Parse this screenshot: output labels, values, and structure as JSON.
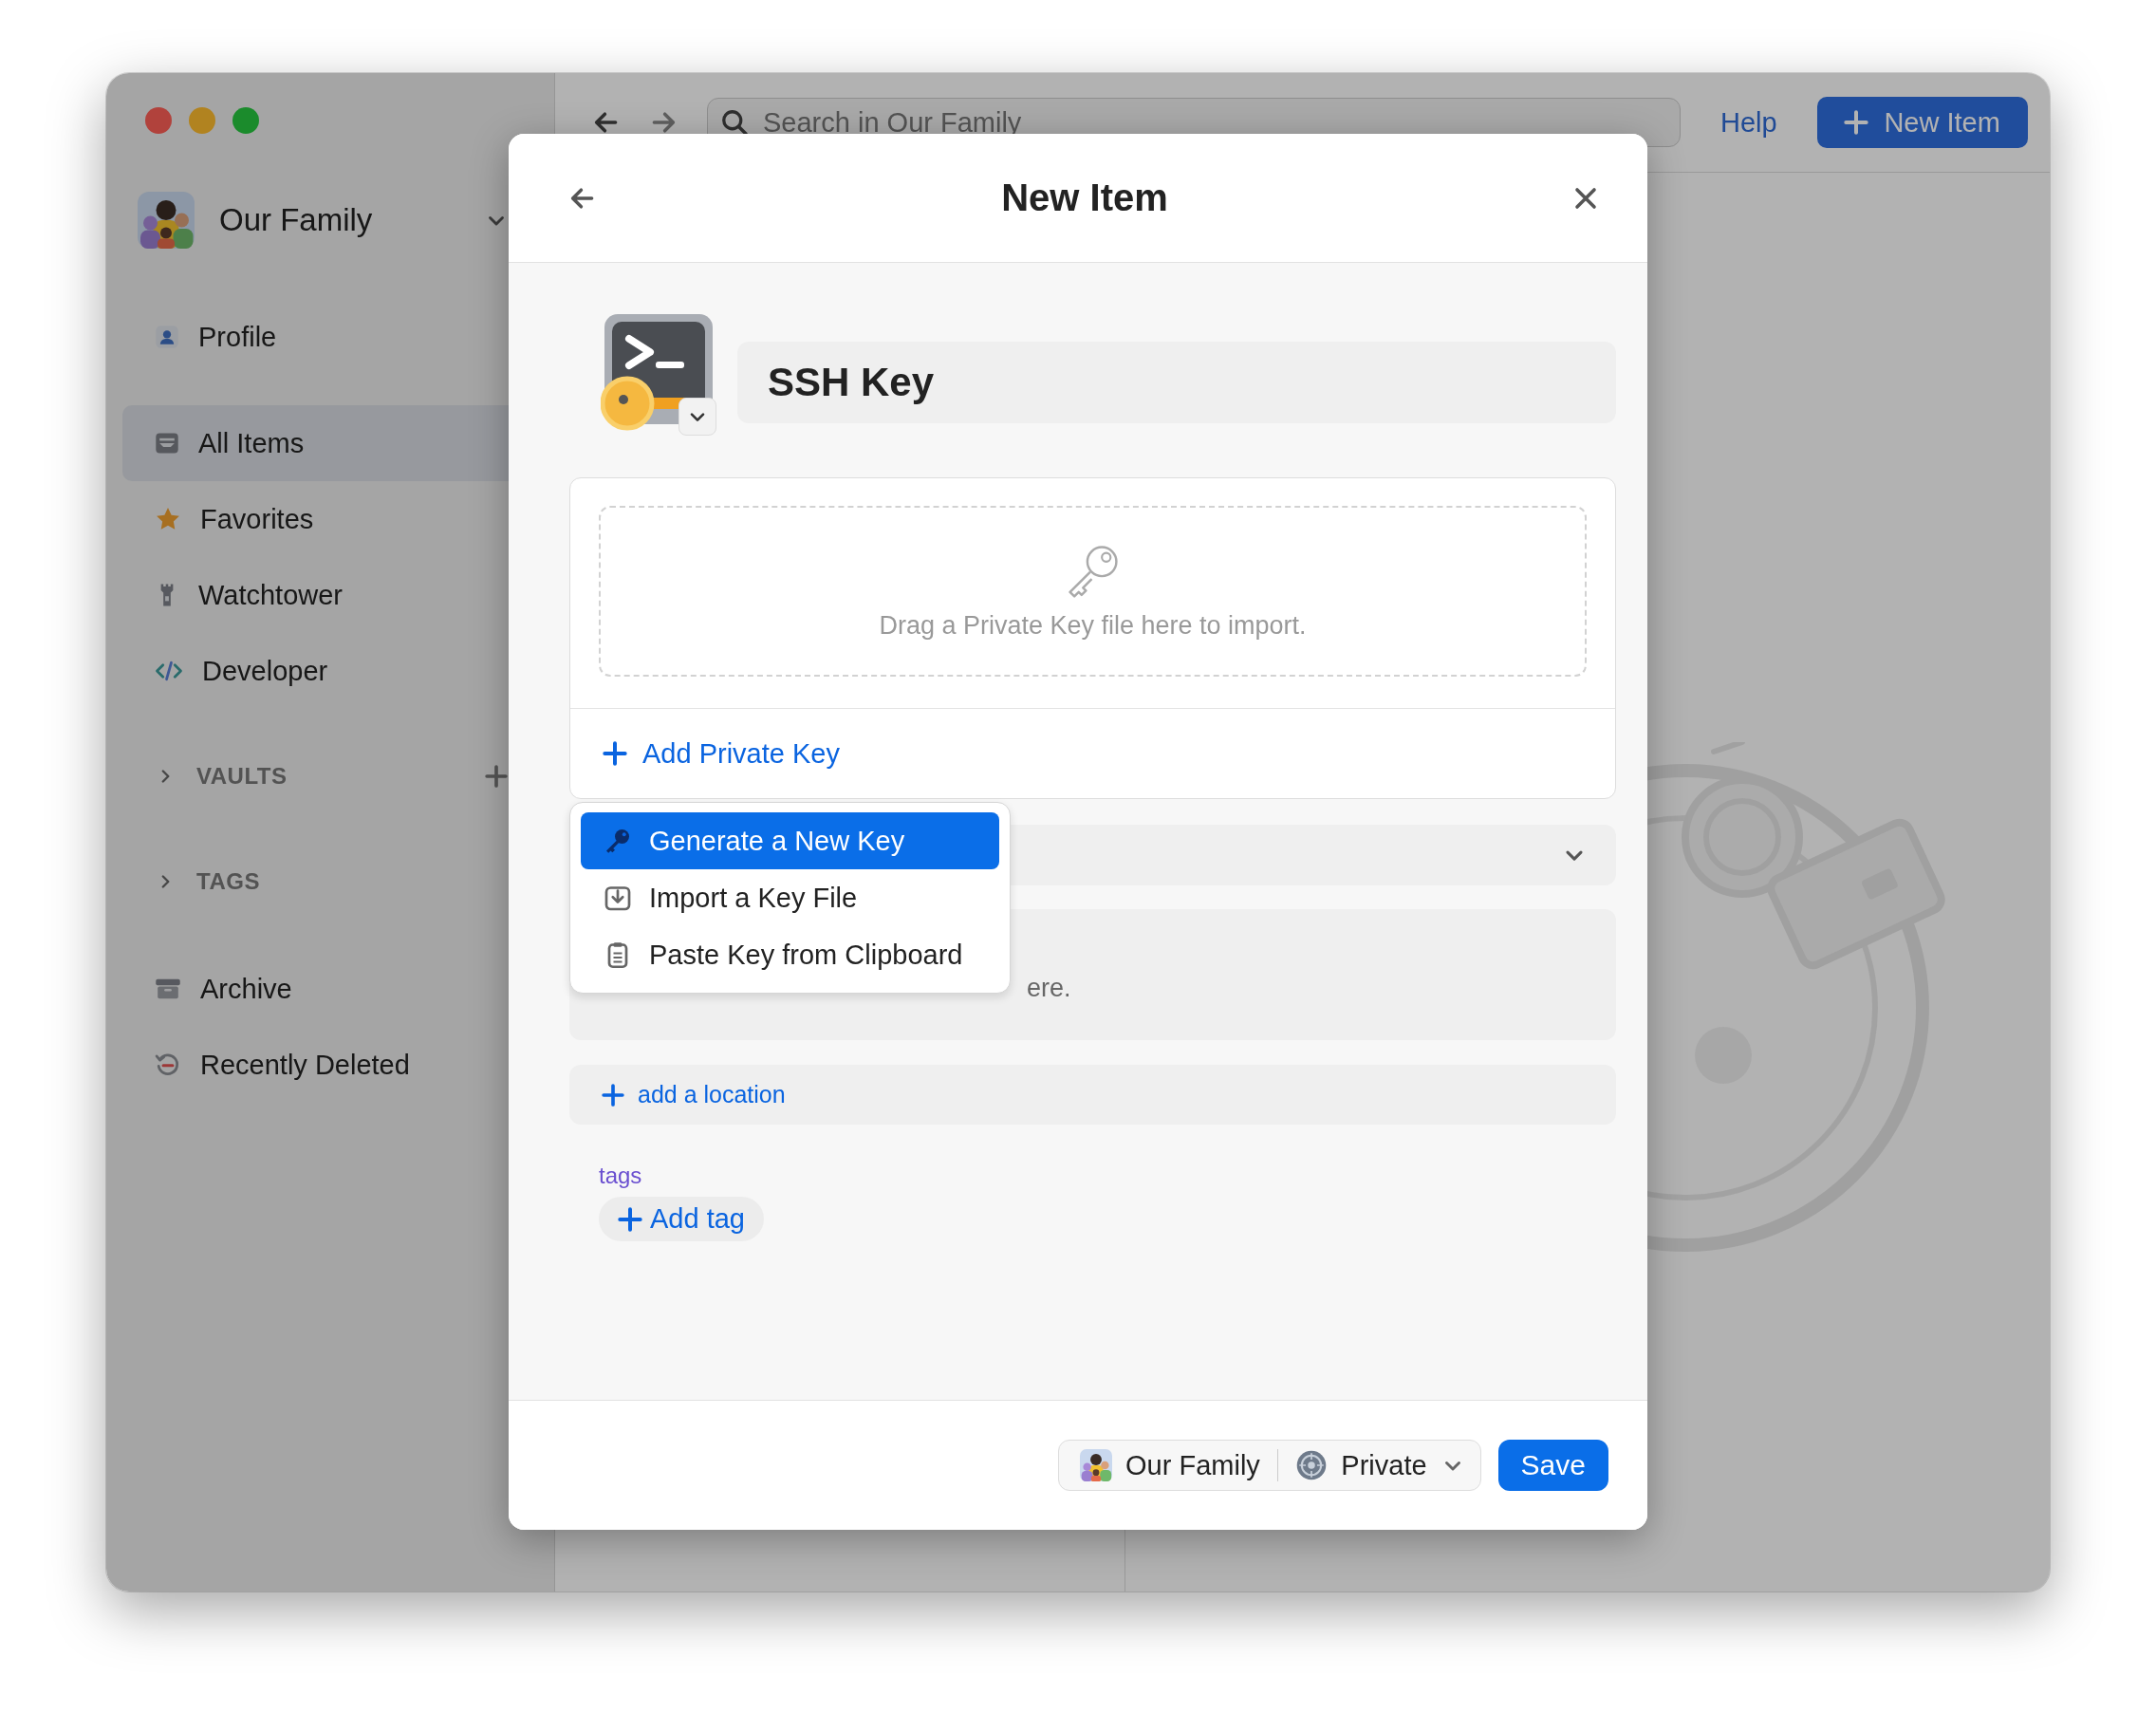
{
  "sidebar": {
    "account": "Our Family",
    "items": [
      {
        "label": "Profile",
        "selected": false
      },
      {
        "label": "All Items",
        "selected": true
      },
      {
        "label": "Favorites",
        "selected": false
      },
      {
        "label": "Watchtower",
        "selected": false
      },
      {
        "label": "Developer",
        "selected": false
      }
    ],
    "sections": [
      {
        "label": "VAULTS",
        "expanded": false,
        "can_add": true
      },
      {
        "label": "TAGS",
        "expanded": false,
        "can_add": false
      }
    ],
    "bottom_items": [
      {
        "label": "Archive",
        "selected": false
      },
      {
        "label": "Recently Deleted",
        "selected": false
      }
    ]
  },
  "toolbar": {
    "search": {
      "placeholder": "Search in Our Family"
    },
    "help": "Help",
    "new_item": "New Item"
  },
  "modal": {
    "title": "New Item",
    "item_name": "SSH Key",
    "drop_zone": "Drag a Private Key file here to import.",
    "add_private_key": "Add Private Key",
    "menu": [
      {
        "label": "Generate a New Key",
        "selected": true
      },
      {
        "label": "Import a Key File",
        "selected": false
      },
      {
        "label": "Paste Key from Clipboard",
        "selected": false
      }
    ],
    "notes_partial": "ere.",
    "add_location": "add a location",
    "tags_label": "tags",
    "add_tag": "Add tag",
    "footer": {
      "account": "Our Family",
      "vault": "Private",
      "save": "Save"
    }
  }
}
